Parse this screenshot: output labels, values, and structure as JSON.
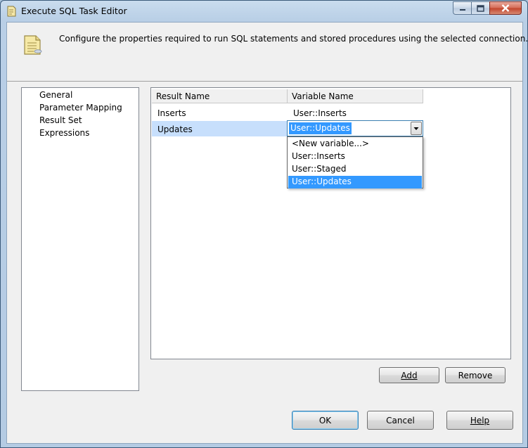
{
  "window": {
    "title": "Execute SQL Task Editor"
  },
  "header": {
    "description": "Configure the properties required to run SQL statements and stored procedures using the selected connection."
  },
  "nav": {
    "items": [
      "General",
      "Parameter Mapping",
      "Result Set",
      "Expressions"
    ],
    "selected": "Result Set"
  },
  "grid": {
    "columns": [
      "Result Name",
      "Variable Name"
    ],
    "rows": [
      {
        "result_name": "Inserts",
        "variable_name": "User::Inserts"
      },
      {
        "result_name": "Updates",
        "variable_name": "User::Updates"
      }
    ],
    "selected_row": "Updates"
  },
  "dropdown": {
    "current_value": "User::Updates",
    "options": [
      "<New variable...>",
      "User::Inserts",
      "User::Staged",
      "User::Updates"
    ],
    "highlighted": "User::Updates"
  },
  "buttons": {
    "add": "Add",
    "remove": "Remove",
    "ok": "OK",
    "cancel": "Cancel",
    "help": "Help"
  },
  "colors": {
    "selection": "#3399ff",
    "row_highlight": "#c7dffc",
    "title_bar": "#b9cfe6",
    "close_button": "#c2432b"
  },
  "icons": {
    "title": "sql-task-icon",
    "header": "sql-task-large-icon",
    "minimize": "minimize-icon",
    "maximize": "maximize-icon",
    "close": "close-icon",
    "combo": "chevron-down-icon"
  }
}
